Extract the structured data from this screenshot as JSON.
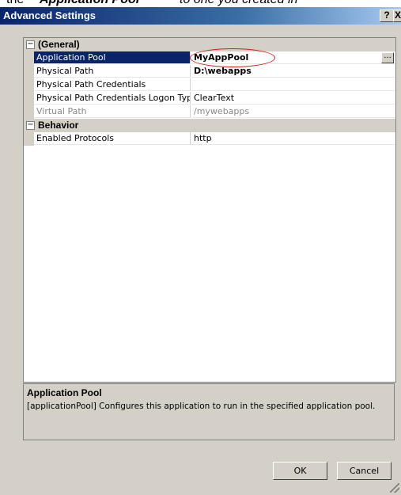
{
  "caption": {
    "lead": "the",
    "bold": "Application Pool",
    "rest": "to one you created in"
  },
  "window": {
    "title": "Advanced Settings",
    "help_label": "?",
    "close_label": "X"
  },
  "categories": [
    {
      "toggle": "−",
      "label": "(General)",
      "properties": [
        {
          "name": "Application Pool",
          "value": "MyAppPool"
        },
        {
          "name": "Physical Path",
          "value": "D:\\webapps"
        },
        {
          "name": "Physical Path Credentials",
          "value": ""
        },
        {
          "name": "Physical Path Credentials Logon Type",
          "value": "ClearText"
        },
        {
          "name": "Virtual Path",
          "value": "/mywebapps"
        }
      ]
    },
    {
      "toggle": "−",
      "label": "Behavior",
      "properties": [
        {
          "name": "Enabled Protocols",
          "value": "http"
        }
      ]
    }
  ],
  "ellipsis_label": "...",
  "description": {
    "title": "Application Pool",
    "text": "[applicationPool] Configures this application to run in the specified application pool."
  },
  "buttons": {
    "ok": "OK",
    "cancel": "Cancel"
  },
  "colors": {
    "selection": "#0a246a",
    "annotation": "#d42020"
  }
}
